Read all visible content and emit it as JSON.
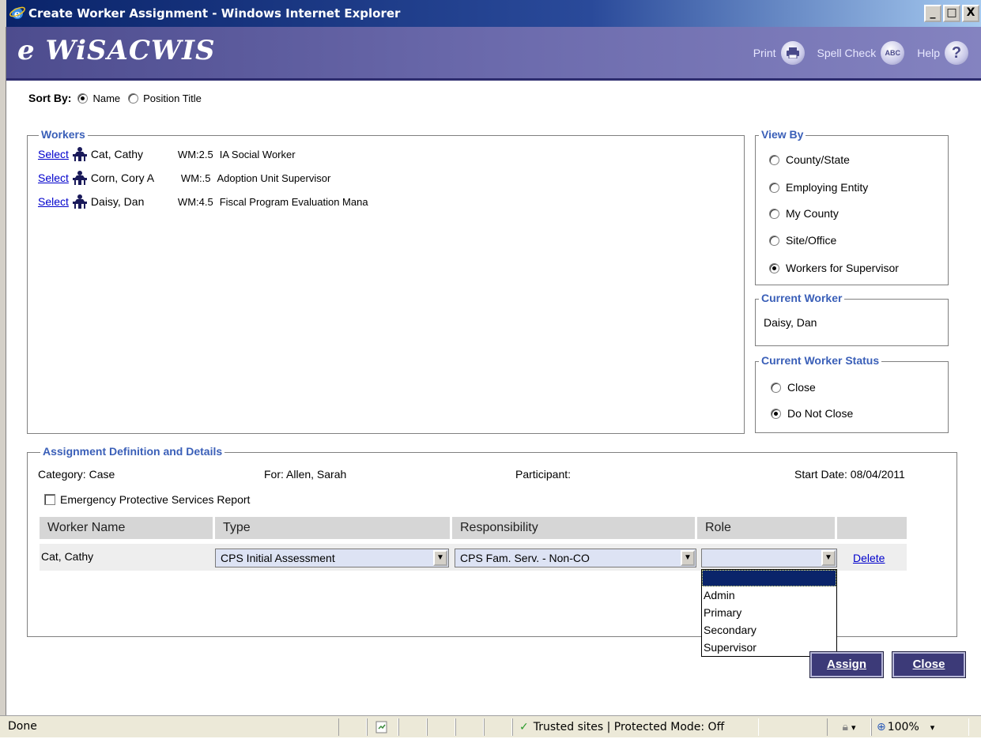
{
  "window": {
    "title": "Create Worker Assignment - Windows Internet Explorer",
    "min": "_",
    "max": "□",
    "close": "X"
  },
  "header": {
    "brand": "e WiSACWIS",
    "print": "Print",
    "spell_check": "Spell Check",
    "help": "Help",
    "spell_icon_text": "ABC",
    "help_icon_text": "?"
  },
  "sort_by": {
    "label": "Sort By:",
    "options": [
      "Name",
      "Position Title"
    ],
    "selected": "Name"
  },
  "workers": {
    "legend": "Workers",
    "rows": [
      {
        "link": "Select",
        "name": "Cat, Cathy",
        "wm": "WM:2.5",
        "title": "IA Social Worker"
      },
      {
        "link": "Select",
        "name": "Corn, Cory A",
        "wm": "WM:.5",
        "title": "Adoption Unit Supervisor"
      },
      {
        "link": "Select",
        "name": "Daisy, Dan",
        "wm": "WM:4.5",
        "title": "Fiscal Program Evaluation Mana"
      }
    ]
  },
  "view_by": {
    "legend": "View By",
    "options": [
      "County/State",
      "Employing Entity",
      "My County",
      "Site/Office",
      "Workers for Supervisor"
    ],
    "selected": "Workers for Supervisor"
  },
  "current_worker": {
    "legend": "Current Worker",
    "name": "Daisy, Dan"
  },
  "current_worker_status": {
    "legend": "Current Worker Status",
    "options": [
      "Close",
      "Do Not Close"
    ],
    "selected": "Do Not Close"
  },
  "assignment": {
    "legend": "Assignment Definition and Details",
    "category": "Category:  Case",
    "for": "For:  Allen, Sarah",
    "participant": "Participant:",
    "start_date": "Start Date:  08/04/2011",
    "emergency_label": "Emergency Protective Services Report",
    "columns": [
      "Worker Name",
      "Type",
      "Responsibility",
      "Role",
      ""
    ],
    "row": {
      "worker_name": "Cat, Cathy",
      "type": "CPS Initial Assessment",
      "responsibility": "CPS Fam. Serv. - Non-CO",
      "role": "",
      "delete": "Delete"
    },
    "role_options": [
      "",
      "Admin",
      "Primary",
      "Secondary",
      "Supervisor"
    ]
  },
  "buttons": {
    "assign": "Assign",
    "close": "Close"
  },
  "statusbar": {
    "status": "Done",
    "zone": "Trusted sites | Protected Mode: Off",
    "zoom": "100%",
    "dropdown_arrow": "▾",
    "zoom_icon": "⊕",
    "zoom_arrow": "▾"
  },
  "colors": {
    "legend": "#3a5fb8",
    "header_bg": "#5b5a9e",
    "button_bg": "#3c3a78",
    "dropdown_selected": "#0a246a"
  }
}
